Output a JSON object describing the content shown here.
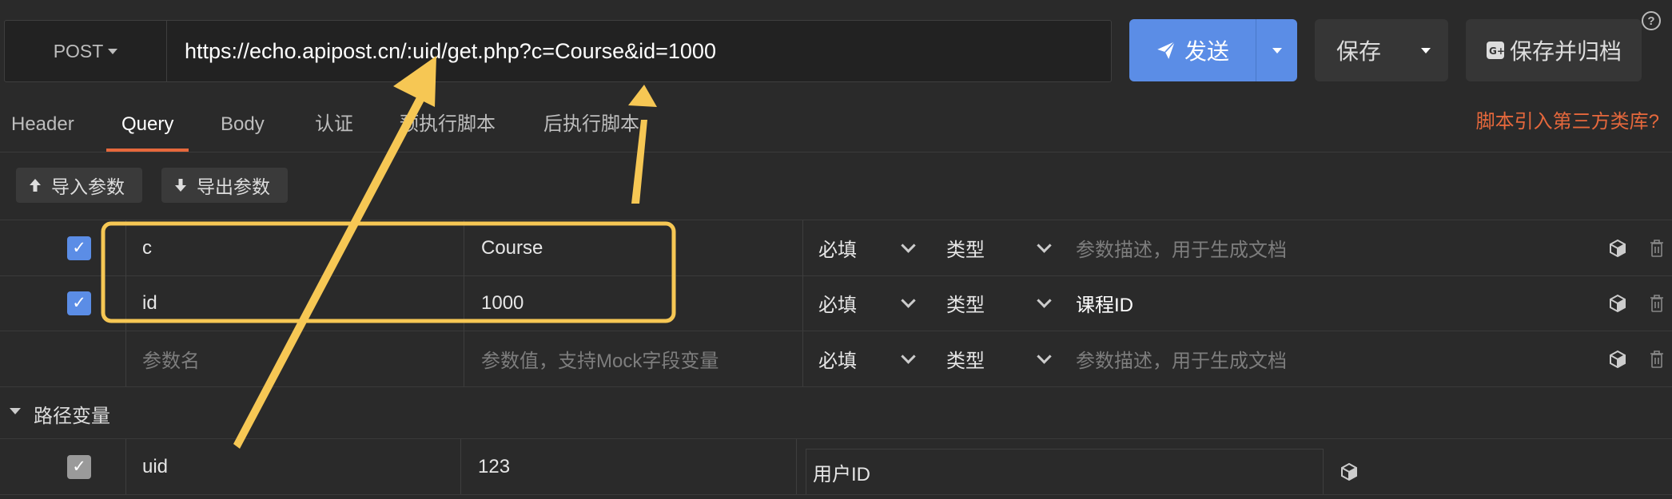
{
  "request": {
    "method": "POST",
    "url": "https://echo.apipost.cn/:uid/get.php?c=Course&id=1000",
    "send_label": "发送",
    "save_label": "保存",
    "save_archive_label": "保存并归档",
    "help_label": "?"
  },
  "tabs": [
    {
      "label": "Header"
    },
    {
      "label": "Query"
    },
    {
      "label": "Body"
    },
    {
      "label": "认证"
    },
    {
      "label": "预执行脚本"
    },
    {
      "label": "后执行脚本"
    }
  ],
  "third_party_link": "脚本引入第三方类库?",
  "param_buttons": {
    "import": "导入参数",
    "export": "导出参数"
  },
  "query_params": [
    {
      "checked": true,
      "name": "c",
      "value": "Course",
      "required": "必填",
      "type": "类型",
      "desc": "",
      "desc_placeholder": "参数描述，用于生成文档"
    },
    {
      "checked": true,
      "name": "id",
      "value": "1000",
      "required": "必填",
      "type": "类型",
      "desc": "课程ID",
      "desc_placeholder": ""
    }
  ],
  "new_param": {
    "name_placeholder": "参数名",
    "value_placeholder": "参数值，支持Mock字段变量",
    "required": "必填",
    "type": "类型",
    "desc_placeholder": "参数描述，用于生成文档"
  },
  "path_section": {
    "label": "路径变量"
  },
  "path_params": [
    {
      "checked": true,
      "name": "uid",
      "value": "123",
      "desc": "用户ID"
    }
  ],
  "colors": {
    "accent": "#5b8de6",
    "link": "#e6683c",
    "highlight": "#f6c754"
  }
}
